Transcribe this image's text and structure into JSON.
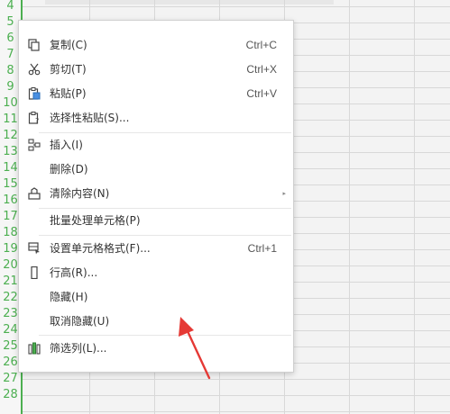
{
  "row_numbers": [
    "4",
    "5",
    "6",
    "7",
    "8",
    "9",
    "10",
    "11",
    "12",
    "13",
    "14",
    "15",
    "16",
    "17",
    "18",
    "19",
    "20",
    "21",
    "22",
    "23",
    "24",
    "25",
    "26",
    "27",
    "28"
  ],
  "menu": {
    "items": [
      {
        "label": "复制(C)",
        "shortcut": "Ctrl+C",
        "icon": "copy-icon"
      },
      {
        "label": "剪切(T)",
        "shortcut": "Ctrl+X",
        "icon": "scissors-icon"
      },
      {
        "label": "粘贴(P)",
        "shortcut": "Ctrl+V",
        "icon": "paste-icon"
      },
      {
        "label": "选择性粘贴(S)...",
        "shortcut": "",
        "icon": "paste-special-icon"
      },
      {
        "label": "插入(I)",
        "shortcut": "",
        "icon": "insert-cells-icon"
      },
      {
        "label": "删除(D)",
        "shortcut": "",
        "icon": ""
      },
      {
        "label": "清除内容(N)",
        "shortcut": "",
        "icon": "eraser-icon",
        "submenu_arrow": "▸"
      },
      {
        "label": "批量处理单元格(P)",
        "shortcut": "",
        "icon": ""
      },
      {
        "label": "设置单元格格式(F)...",
        "shortcut": "Ctrl+1",
        "icon": "format-cells-icon"
      },
      {
        "label": "行高(R)...",
        "shortcut": "",
        "icon": "row-height-icon"
      },
      {
        "label": "隐藏(H)",
        "shortcut": "",
        "icon": ""
      },
      {
        "label": "取消隐藏(U)",
        "shortcut": "",
        "icon": ""
      },
      {
        "label": "筛选列(L)...",
        "shortcut": "",
        "icon": "filter-columns-icon"
      }
    ]
  },
  "colors": {
    "row_header_text": "#4caf50",
    "annotation_arrow": "#e53935"
  }
}
